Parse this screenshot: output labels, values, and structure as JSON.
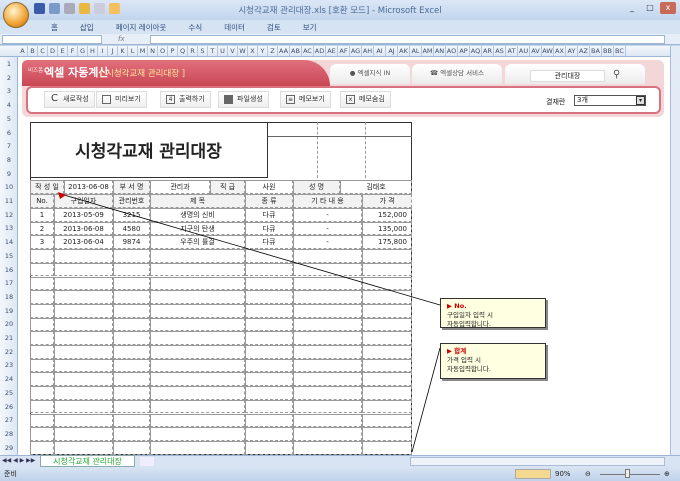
{
  "window": {
    "title": "시청각교재 관리대장.xls [호환 모드] - Microsoft Excel",
    "controls": [
      "_",
      "□",
      "x"
    ]
  },
  "ribbon_tabs": [
    "홈",
    "삽입",
    "페이지 레이아웃",
    "수식",
    "데이터",
    "검토",
    "보기"
  ],
  "formula_bar": {
    "fx": "fx"
  },
  "columns": [
    "A",
    "B",
    "C",
    "D",
    "E",
    "F",
    "G",
    "H",
    "I",
    "J",
    "K",
    "L",
    "M",
    "N",
    "O",
    "P",
    "Q",
    "R",
    "S",
    "T",
    "U",
    "V",
    "W",
    "X",
    "Y",
    "Z",
    "AA",
    "AB",
    "AC",
    "AD",
    "AE",
    "AF",
    "AG",
    "AH",
    "AI",
    "AJ",
    "AK",
    "AL",
    "AM",
    "AN",
    "AO",
    "AP",
    "AQ",
    "AR",
    "AS",
    "AT",
    "AU",
    "AV",
    "AW",
    "AX",
    "AY",
    "AZ",
    "BA",
    "BB",
    "BC"
  ],
  "rows": [
    "1",
    "2",
    "3",
    "4",
    "5",
    "6",
    "7",
    "8",
    "9",
    "10",
    "11",
    "12",
    "13",
    "14",
    "15",
    "16",
    "17",
    "18",
    "19",
    "20",
    "21",
    "22",
    "23",
    "24",
    "25",
    "26",
    "27",
    "28",
    "29"
  ],
  "banner": {
    "brand_small": "비즈폼",
    "brand": "엑셀 자동계산",
    "subtitle": "[ 시청각교재 관리대장 ]",
    "tab1": "엑셀지식 IN",
    "tab2": "엑셀상담 서비스",
    "search_value": "관리대장"
  },
  "toolbar": {
    "buttons": [
      "새로작성",
      "미리보기",
      "출력하기",
      "파일생성",
      "메모보기",
      "메모숨김"
    ],
    "approval_label": "결재란",
    "approval_value": "3개"
  },
  "form": {
    "title": "시청각교재 관리대장",
    "info": {
      "date_label": "작 성 일",
      "date": "2013-06-08",
      "dept_label": "부 서 명",
      "dept": "관리과",
      "rank_label": "직  급",
      "rank": "사원",
      "name_label": "성  명",
      "name": "김태호"
    },
    "headers": [
      "No.",
      "구입일자",
      "관리번호",
      "제   목",
      "종  류",
      "기 타 내 용",
      "가   격"
    ],
    "rows": [
      [
        "1",
        "2013-05-09",
        "3215",
        "생명의 신비",
        "다큐",
        "-",
        "152,000"
      ],
      [
        "2",
        "2013-06-08",
        "4580",
        "지구의 탄생",
        "다큐",
        "-",
        "135,000"
      ],
      [
        "3",
        "2013-06-04",
        "9874",
        "우주의 률걸",
        "다큐",
        "-",
        "175,800"
      ]
    ]
  },
  "notes": [
    {
      "title": "No.",
      "lines": [
        "구입일자 입력 시",
        "자동입력합니다."
      ]
    },
    {
      "title": "합계",
      "lines": [
        "가격 입력 시",
        "자동입력합니다."
      ]
    }
  ],
  "sheet_tab": "시청각교재 관리대장",
  "status": {
    "text": "준비",
    "zoom": "90%"
  }
}
